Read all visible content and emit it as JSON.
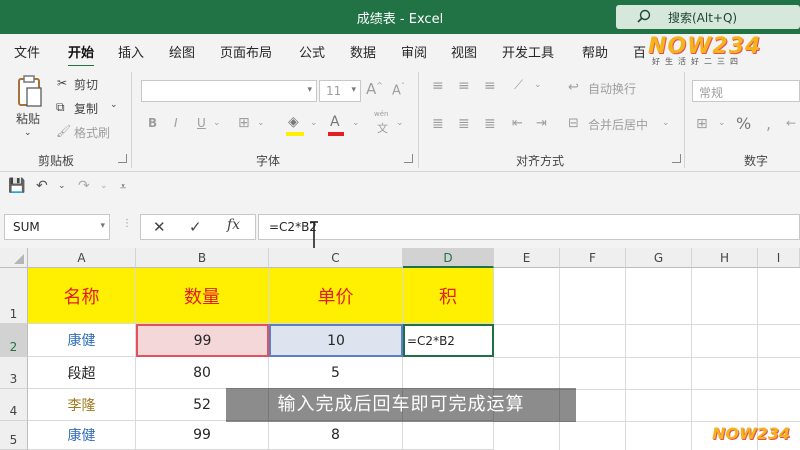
{
  "window": {
    "title": "成绩表 - Excel",
    "search_label": "搜索(Alt+Q)"
  },
  "tabs": [
    {
      "label": "文件"
    },
    {
      "label": "开始"
    },
    {
      "label": "插入"
    },
    {
      "label": "绘图"
    },
    {
      "label": "页面布局"
    },
    {
      "label": "公式"
    },
    {
      "label": "数据"
    },
    {
      "label": "审阅"
    },
    {
      "label": "视图"
    },
    {
      "label": "开发工具"
    },
    {
      "label": "帮助"
    },
    {
      "label": "百"
    }
  ],
  "watermark": {
    "text": "NOW234",
    "sub": "好生活好二三四"
  },
  "ribbon": {
    "clipboard": {
      "paste": "粘贴",
      "cut": "剪切",
      "copy": "复制",
      "painter": "格式刷",
      "label": "剪贴板"
    },
    "font": {
      "font_size": "11",
      "label": "字体",
      "bold": "B",
      "italic": "I",
      "underline": "U",
      "phonetic_top": "wén",
      "phonetic_bottom": "文"
    },
    "align": {
      "wrap": "自动换行",
      "merge": "合并后居中",
      "label": "对齐方式"
    },
    "number": {
      "format": "常规",
      "label": "数字",
      "percent": "%"
    }
  },
  "formula_bar": {
    "name_box": "SUM",
    "formula": "=C2*B2"
  },
  "columns": [
    "A",
    "B",
    "C",
    "D",
    "E",
    "F",
    "G",
    "H",
    "I"
  ],
  "rows": [
    "1",
    "2",
    "3",
    "4",
    "5"
  ],
  "table": {
    "headers": [
      "名称",
      "数量",
      "单价",
      "积"
    ],
    "data": [
      [
        "康健",
        "99",
        "10",
        "=C2*B2"
      ],
      [
        "段超",
        "80",
        "5",
        ""
      ],
      [
        "李隆",
        "52",
        "",
        ""
      ],
      [
        "康健",
        "99",
        "8",
        ""
      ]
    ]
  },
  "subtitle": "输入完成后回车即可完成运算",
  "colors": {
    "accent": "#217346",
    "header_fill": "#ffef00",
    "header_text": "#e02020"
  }
}
